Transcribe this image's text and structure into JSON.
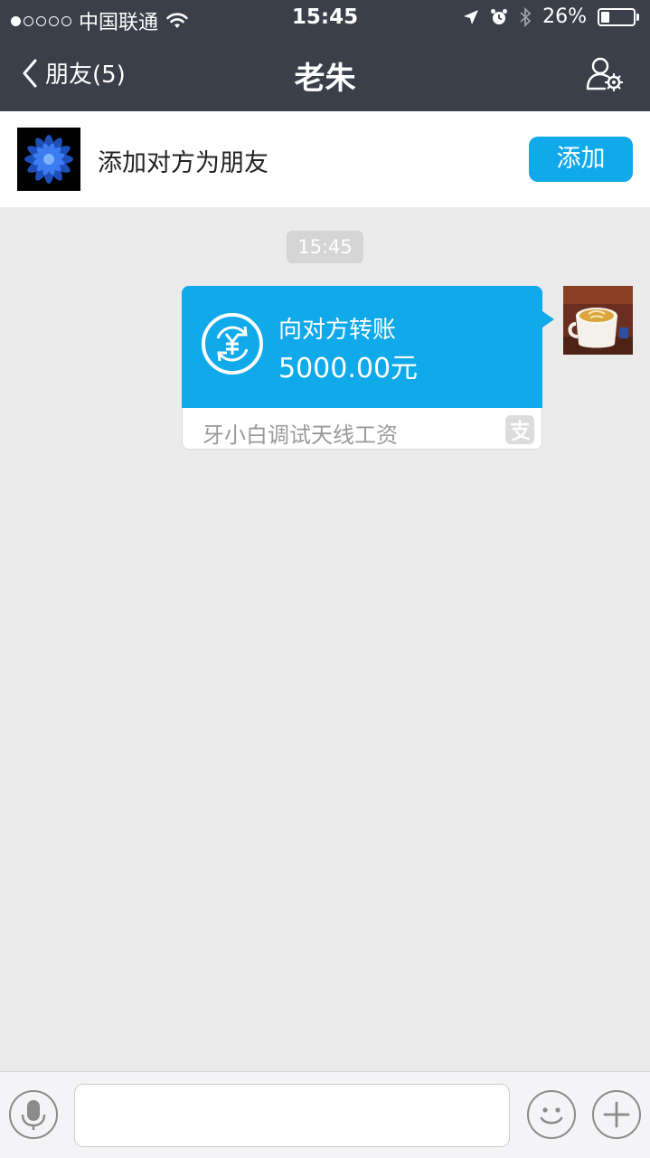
{
  "status_bar": {
    "carrier": "中国联通",
    "time": "15:45",
    "battery_percent": "26%",
    "battery_level": 0.26,
    "signal_dots_filled": 1
  },
  "nav": {
    "back_label": "朋友(5)",
    "title": "老朱"
  },
  "banner": {
    "text": "添加对方为朋友",
    "add_button": "添加"
  },
  "chat": {
    "timestamp": "15:45",
    "transfer": {
      "title": "向对方转账",
      "amount": "5000.00元",
      "memo": "牙小白调试天线工资"
    }
  },
  "colors": {
    "nav_bg": "#3a3f49",
    "accent": "#10a9ea",
    "chat_bg": "#ebebeb"
  }
}
